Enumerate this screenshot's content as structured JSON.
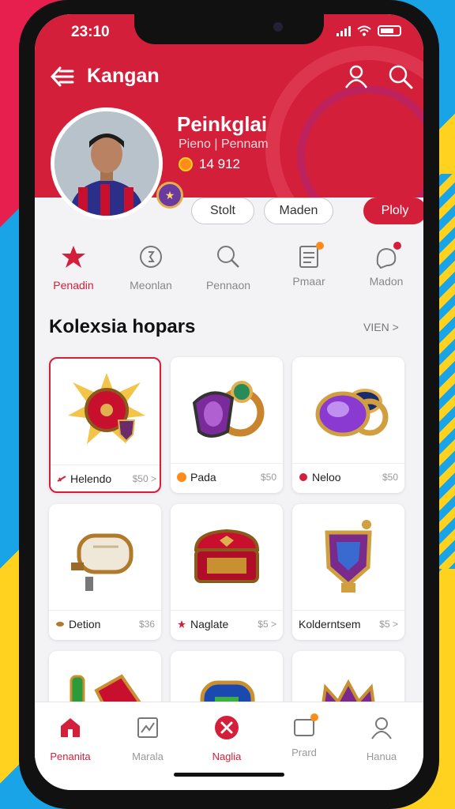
{
  "status": {
    "time": "23:10"
  },
  "header": {
    "title": "Kangan",
    "profile_name": "Peinkglai",
    "profile_sub": "Pieno | Pennam",
    "coins": "14 912"
  },
  "actions": {
    "pill_1": "Stolt",
    "pill_2": "Maden",
    "pill_3": "Ploly"
  },
  "categories": [
    {
      "label": "Penadin",
      "icon": "star-icon"
    },
    {
      "label": "Meonlan",
      "icon": "coin-icon"
    },
    {
      "label": "Pennaon",
      "icon": "magnifier-icon"
    },
    {
      "label": "Pmaar",
      "icon": "document-icon"
    },
    {
      "label": "Madon",
      "icon": "chat-icon"
    }
  ],
  "section": {
    "title": "Kolexsia hopars",
    "more": "VIEN >"
  },
  "items": [
    {
      "name": "Helendo",
      "price": "$50 >",
      "art": "spiked-shield"
    },
    {
      "name": "Pada",
      "price": "$50",
      "art": "purple-ring"
    },
    {
      "name": "Neloo",
      "price": "$50",
      "art": "amethyst-ring"
    },
    {
      "name": "Detion",
      "price": "$36",
      "art": "scroll"
    },
    {
      "name": "Naglate",
      "price": "$5 >",
      "art": "red-chest"
    },
    {
      "name": "Kolderntsem",
      "price": "$5 >",
      "art": "purple-shield"
    },
    {
      "name": "",
      "price": "",
      "art": "potion"
    },
    {
      "name": "",
      "price": "",
      "art": "blue-pack"
    },
    {
      "name": "",
      "price": "",
      "art": "blue-crown"
    }
  ],
  "tabs": [
    {
      "label": "Penanita",
      "icon": "home-icon"
    },
    {
      "label": "Marala",
      "icon": "gallery-icon"
    },
    {
      "label": "Naglia",
      "icon": "tools-icon"
    },
    {
      "label": "Prard",
      "icon": "message-icon"
    },
    {
      "label": "Hanua",
      "icon": "profile-icon"
    }
  ],
  "colors": {
    "accent": "#d31f3a",
    "background": "#f3f3f5"
  }
}
